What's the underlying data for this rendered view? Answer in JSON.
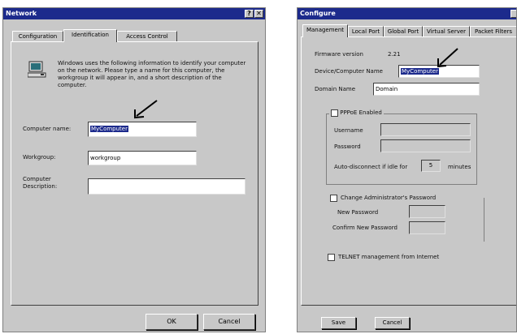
{
  "network_dialog": {
    "title": "Network",
    "help_button": "?",
    "close_button": "✕",
    "tabs": [
      "Configuration",
      "Identification",
      "Access Control"
    ],
    "description": "Windows uses the following information to identify your computer on the network. Please type a name for this computer, the workgroup it will appear in, and a short description of the computer.",
    "computer_name_label": "Computer name:",
    "computer_name_value": "MyComputer",
    "workgroup_label": "Workgroup:",
    "workgroup_value": "workgroup",
    "description_label_line1": "Computer",
    "description_label_line2": "Description:",
    "description_value": "",
    "ok_button": "OK",
    "cancel_button": "Cancel"
  },
  "configure_dialog": {
    "title": "Configure",
    "tabs": [
      "Management",
      "Local Port",
      "Global Port",
      "Virtual Server",
      "Packet Filters"
    ],
    "firmware_label": "Firmware version",
    "firmware_value": "2.21",
    "device_name_label": "Device/Computer Name",
    "device_name_value": "MyComputer",
    "domain_name_label": "Domain Name",
    "domain_name_value": "Domain",
    "pppoe_label": "PPPoE Enabled",
    "username_label": "Username",
    "password_label": "Password",
    "autodisconnect_label": "Auto-disconnect if idle for",
    "autodisconnect_value": "5",
    "minutes_label": "minutes",
    "change_admin_label": "Change Administrator's Password",
    "new_password_label": "New Password",
    "confirm_password_label": "Confirm New Password",
    "telnet_label": "TELNET management from Internet",
    "save_button": "Save",
    "cancel_button": "Cancel"
  }
}
